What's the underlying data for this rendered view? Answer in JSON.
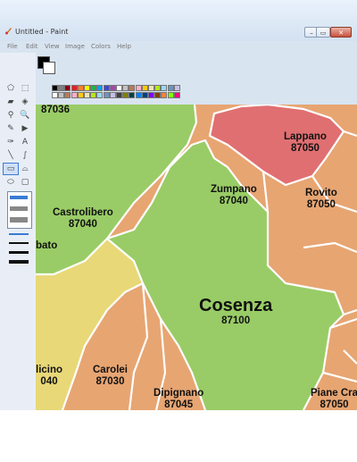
{
  "window": {
    "title": "Untitled - Paint"
  },
  "menu": [
    "File",
    "Edit",
    "View",
    "Image",
    "Colors",
    "Help"
  ],
  "tools": [
    {
      "icon": "free-select-icon",
      "glyph": "⬠"
    },
    {
      "icon": "rect-select-icon",
      "glyph": "⬚"
    },
    {
      "icon": "eraser-icon",
      "glyph": "▰"
    },
    {
      "icon": "fill-icon",
      "glyph": "◈"
    },
    {
      "icon": "color-picker-icon",
      "glyph": "⚲"
    },
    {
      "icon": "magnifier-icon",
      "glyph": "🔍"
    },
    {
      "icon": "pencil-icon",
      "glyph": "✎"
    },
    {
      "icon": "brush-icon",
      "glyph": "▶"
    },
    {
      "icon": "airbrush-icon",
      "glyph": "✑"
    },
    {
      "icon": "text-icon",
      "glyph": "A"
    },
    {
      "icon": "line-icon",
      "glyph": "╲"
    },
    {
      "icon": "curve-icon",
      "glyph": "∫"
    },
    {
      "icon": "rectangle-icon",
      "glyph": "▭"
    },
    {
      "icon": "polygon-icon",
      "glyph": "⌓"
    },
    {
      "icon": "ellipse-icon",
      "glyph": "⬭"
    },
    {
      "icon": "rounded-rect-icon",
      "glyph": "▢"
    }
  ],
  "palette": {
    "primary": "#000000",
    "secondary": "#ffffff",
    "row1": [
      "#000000",
      "#7f7f7f",
      "#880015",
      "#ed1c24",
      "#ff7f27",
      "#fff200",
      "#22b14c",
      "#00a2e8",
      "#3f48cc",
      "#a349a4",
      "#ffffff",
      "#c3c3c3",
      "#b97a57",
      "#ffaec9",
      "#ffc90e",
      "#efe4b0",
      "#b5e61d",
      "#99d9ea",
      "#7092be",
      "#c8bfe7"
    ],
    "row2": [
      "#ffffff",
      "#c3c3c3",
      "#b97a57",
      "#ffaec9",
      "#ffc90e",
      "#efe4b0",
      "#b5e61d",
      "#99d9ea",
      "#7092be",
      "#c8bfe7",
      "#404040",
      "#808000",
      "#004040",
      "#0080ff",
      "#004080",
      "#8000ff",
      "#804000",
      "#ff8040",
      "#80ff00",
      "#ff0080"
    ]
  },
  "map": {
    "colors": {
      "green": "#99cc66",
      "orange": "#e8a572",
      "red": "#e06f72",
      "yellow": "#e8d878",
      "border": "#ffffff"
    },
    "labels": {
      "top_left_code": "87036",
      "lappano": {
        "name": "Lappano",
        "code": "87050"
      },
      "zumpano": {
        "name": "Zumpano",
        "code": "87040"
      },
      "rovito": {
        "name": "Rovito",
        "code": "87050"
      },
      "castrolibero": {
        "name": "Castrolibero",
        "code": "87040"
      },
      "partial_left": {
        "name": "bato"
      },
      "cosenza": {
        "name": "Cosenza",
        "code": "87100"
      },
      "partial_dicino": {
        "name": "licino",
        "code": "040"
      },
      "carolei": {
        "name": "Carolei",
        "code": "87030"
      },
      "dipignano": {
        "name": "Dipignano",
        "code": "87045"
      },
      "piane": {
        "name": "Piane Cra",
        "code": "87050"
      }
    }
  }
}
